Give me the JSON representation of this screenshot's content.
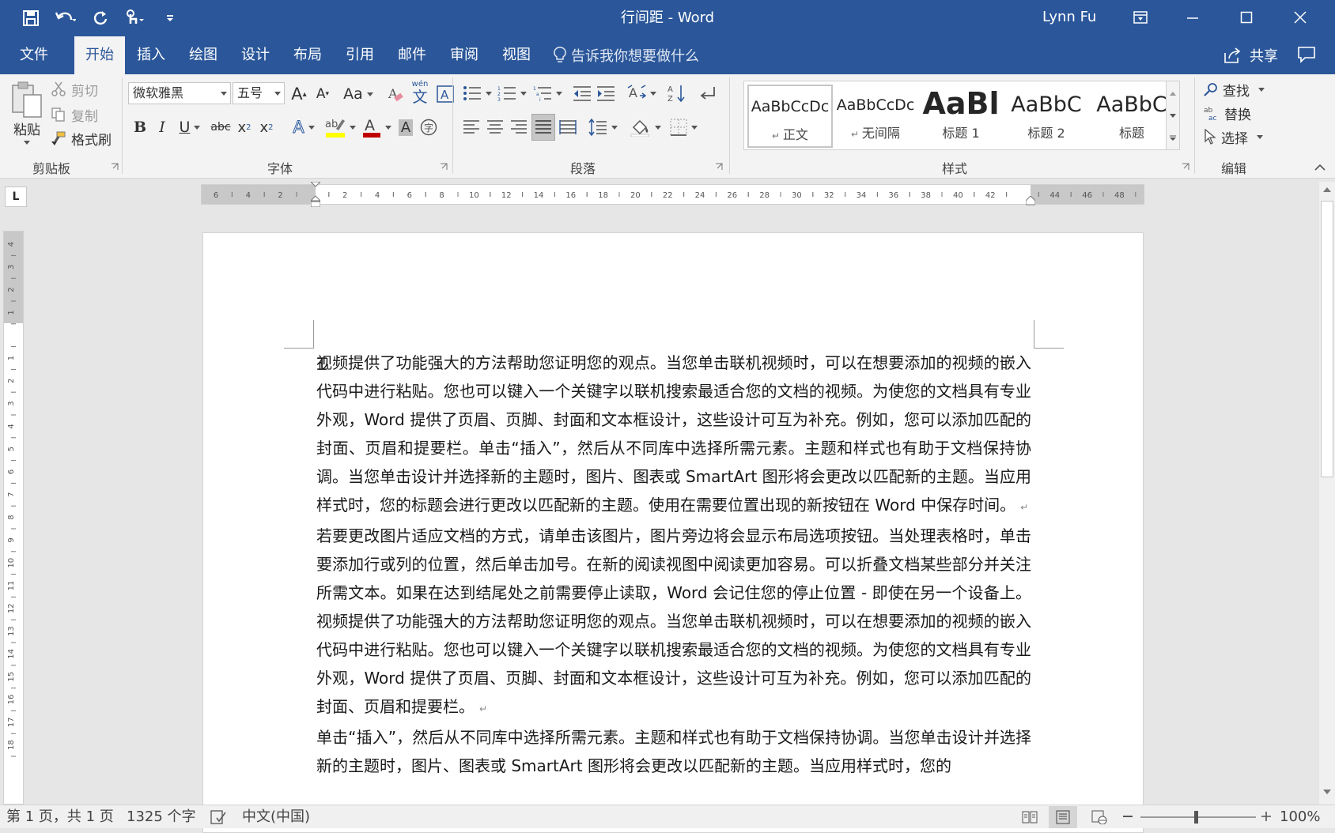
{
  "window": {
    "title": "行间距 - Word",
    "user": "Lynn Fu"
  },
  "tabs": [
    "文件",
    "开始",
    "插入",
    "绘图",
    "设计",
    "布局",
    "引用",
    "邮件",
    "审阅",
    "视图"
  ],
  "active_tab": "开始",
  "tell_me": "告诉我你想要做什么",
  "share": "共享",
  "clipboard": {
    "paste": "粘贴",
    "cut": "剪切",
    "copy": "复制",
    "format_painter": "格式刷",
    "label": "剪贴板"
  },
  "font": {
    "name": "微软雅黑",
    "size": "五号",
    "label": "字体",
    "case": "Aa",
    "phonetic": "wén"
  },
  "paragraph": {
    "label": "段落"
  },
  "styles": {
    "label": "样式",
    "items": [
      {
        "preview": "AaBbCcDc",
        "name": "正文"
      },
      {
        "preview": "AaBbCcDc",
        "name": "无间隔"
      },
      {
        "preview": "AaBl",
        "name": "标题 1"
      },
      {
        "preview": "AaBbC",
        "name": "标题 2"
      },
      {
        "preview": "AaBbC",
        "name": "标题"
      }
    ]
  },
  "editing": {
    "find": "查找",
    "replace": "替换",
    "select": "选择",
    "label": "编辑"
  },
  "ruler_h": [
    "6",
    "4",
    "2",
    "",
    "2",
    "4",
    "6",
    "8",
    "10",
    "12",
    "14",
    "16",
    "18",
    "20",
    "22",
    "24",
    "26",
    "28",
    "30",
    "32",
    "34",
    "36",
    "38",
    "40",
    "42",
    "",
    "44",
    "46",
    "48"
  ],
  "ruler_v": [
    "4",
    "3",
    "2",
    "1",
    "",
    "1",
    "2",
    "3",
    "4",
    "5",
    "6",
    "7",
    "8",
    "9",
    "10",
    "11",
    "12",
    "13",
    "14",
    "15",
    "16",
    "17",
    "18"
  ],
  "document": {
    "paragraphs": [
      "视频提供了功能强大的方法帮助您证明您的观点。当您单击联机视频时，可以在想要添加的视频的嵌入代码中进行粘贴。您也可以键入一个关键字以联机搜索最适合您的文档的视频。为使您的文档具有专业外观，Word 提供了页眉、页脚、封面和文本框设计，这些设计可互为补充。例如，您可以添加匹配的封面、页眉和提要栏。单击“插入”，然后从不同库中选择所需元素。主题和样式也有助于文档保持协调。当您单击设计并选择新的主题时，图片、图表或 SmartArt 图形将会更改以匹配新的主题。当应用样式时，您的标题会进行更改以匹配新的主题。使用在需要位置出现的新按钮在 Word 中保存时间。",
      "若要更改图片适应文档的方式，请单击该图片，图片旁边将会显示布局选项按钮。当处理表格时，单击要添加行或列的位置，然后单击加号。在新的阅读视图中阅读更加容易。可以折叠文档某些部分并关注所需文本。如果在达到结尾处之前需要停止读取，Word 会记住您的停止位置 - 即使在另一个设备上。视频提供了功能强大的方法帮助您证明您的观点。当您单击联机视频时，可以在想要添加的视频的嵌入代码中进行粘贴。您也可以键入一个关键字以联机搜索最适合您的文档的视频。为使您的文档具有专业外观，Word 提供了页眉、页脚、封面和文本框设计，这些设计可互为补充。例如，您可以添加匹配的封面、页眉和提要栏。",
      "单击“插入”，然后从不同库中选择所需元素。主题和样式也有助于文档保持协调。当您单击设计并选择新的主题时，图片、图表或 SmartArt 图形将会更改以匹配新的主题。当应用样式时，您的"
    ],
    "paragraph_mark": "↵"
  },
  "status": {
    "page": "第 1 页，共 1 页",
    "words": "1325 个字",
    "language": "中文(中国)",
    "zoom": "100%"
  },
  "colors": {
    "accent": "#2b579a",
    "ribbon_bg": "#f3f3f3",
    "font_color_bar": "#c00000",
    "highlight_bar": "#ffff00"
  },
  "icons": [
    "save-icon",
    "undo-icon",
    "redo-icon",
    "touch-mode-icon",
    "customize-qat-icon",
    "ribbon-display-icon",
    "minimize-icon",
    "maximize-icon",
    "close-icon",
    "lightbulb-icon",
    "share-icon",
    "comments-icon"
  ]
}
